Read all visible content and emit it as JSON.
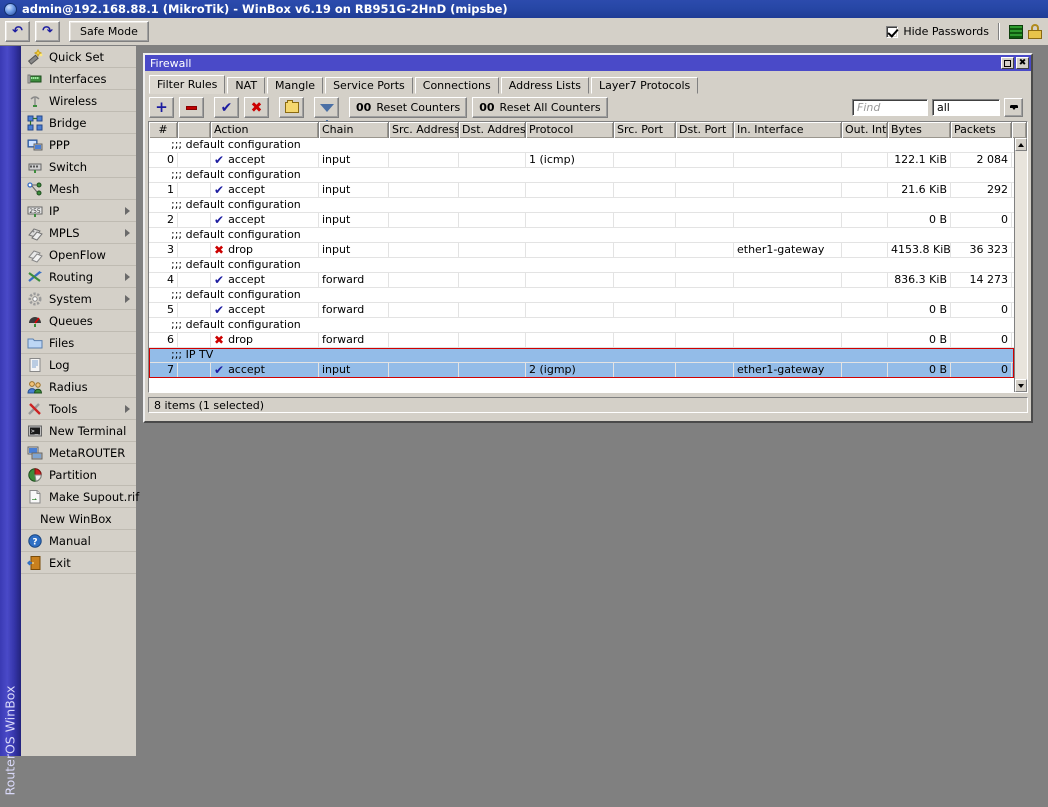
{
  "window": {
    "title": "admin@192.168.88.1 (MikroTik) - WinBox v6.19 on RB951G-2HnD (mipsbe)",
    "logo_icon": "winbox-globe-icon"
  },
  "main_toolbar": {
    "undo_label": "↶",
    "undo_icon": "undo-icon",
    "redo_label": "↷",
    "redo_icon": "redo-icon",
    "safe_mode_label": "Safe Mode",
    "hide_passwords_label": "Hide Passwords",
    "hide_passwords_checked": true,
    "bars_icon": "green-bars-icon",
    "lock_icon": "lock-icon"
  },
  "sidebar": {
    "vertical_label": "RouterOS WinBox",
    "items": [
      {
        "label": "Quick Set",
        "icon": "magic-wand-icon",
        "has_arrow": false
      },
      {
        "label": "Interfaces",
        "icon": "interfaces-icon",
        "has_arrow": false
      },
      {
        "label": "Wireless",
        "icon": "antenna-icon",
        "has_arrow": false
      },
      {
        "label": "Bridge",
        "icon": "bridge-icon",
        "has_arrow": false
      },
      {
        "label": "PPP",
        "icon": "ppp-icon",
        "has_arrow": false
      },
      {
        "label": "Switch",
        "icon": "switch-icon",
        "has_arrow": false
      },
      {
        "label": "Mesh",
        "icon": "mesh-icon",
        "has_arrow": false
      },
      {
        "label": "IP",
        "icon": "ip-255-icon",
        "has_arrow": true
      },
      {
        "label": "MPLS",
        "icon": "mpls-tag-icon",
        "has_arrow": true
      },
      {
        "label": "OpenFlow",
        "icon": "openflow-tag-icon",
        "has_arrow": false
      },
      {
        "label": "Routing",
        "icon": "routing-icon",
        "has_arrow": true
      },
      {
        "label": "System",
        "icon": "gear-icon",
        "has_arrow": true
      },
      {
        "label": "Queues",
        "icon": "queues-gauge-icon",
        "has_arrow": false
      },
      {
        "label": "Files",
        "icon": "folder-icon",
        "has_arrow": false
      },
      {
        "label": "Log",
        "icon": "log-document-icon",
        "has_arrow": false
      },
      {
        "label": "Radius",
        "icon": "radius-users-icon",
        "has_arrow": false
      },
      {
        "label": "Tools",
        "icon": "tools-wrench-icon",
        "has_arrow": true
      },
      {
        "label": "New Terminal",
        "icon": "terminal-icon",
        "has_arrow": false
      },
      {
        "label": "MetaROUTER",
        "icon": "metarouter-icon",
        "has_arrow": false
      },
      {
        "label": "Partition",
        "icon": "pie-chart-icon",
        "has_arrow": false
      },
      {
        "label": "Make Supout.rif",
        "icon": "supout-file-icon",
        "has_arrow": false
      },
      {
        "label": "New WinBox",
        "icon": "",
        "has_arrow": false
      },
      {
        "label": "Manual",
        "icon": "question-mark-icon",
        "has_arrow": false
      },
      {
        "label": "Exit",
        "icon": "exit-door-icon",
        "has_arrow": false
      }
    ]
  },
  "firewall": {
    "title": "Firewall",
    "maximize_icon": "maximize-icon",
    "close_label": "✖",
    "close_icon": "close-icon",
    "tabs": [
      {
        "label": "Filter Rules",
        "active": true
      },
      {
        "label": "NAT",
        "active": false
      },
      {
        "label": "Mangle",
        "active": false
      },
      {
        "label": "Service Ports",
        "active": false
      },
      {
        "label": "Connections",
        "active": false
      },
      {
        "label": "Address Lists",
        "active": false
      },
      {
        "label": "Layer7 Protocols",
        "active": false
      }
    ],
    "toolbar": {
      "add_icon": "plus-icon",
      "remove_icon": "minus-icon",
      "enable_icon": "check-icon",
      "disable_icon": "red-x-icon",
      "comment_icon": "folder-icon",
      "filter_icon": "funnel-icon",
      "reset_counters_prefix": "00",
      "reset_counters_label": "Reset Counters",
      "reset_all_counters_prefix": "00",
      "reset_all_counters_label": "Reset All Counters",
      "find_placeholder": "Find",
      "find_value": "",
      "filter_selected": "all",
      "dropdown_icon": "chevron-down-icon"
    },
    "columns": [
      "#",
      "",
      "Action",
      "Chain",
      "Src. Address",
      "Dst. Address",
      "Protocol",
      "Src. Port",
      "Dst. Port",
      "In. Interface",
      "Out. Int...",
      "Bytes",
      "Packets"
    ],
    "rows": [
      {
        "type": "comment",
        "text": ";;; default configuration",
        "selected": false
      },
      {
        "type": "rule",
        "index": "0",
        "action": "accept",
        "action_icon": "check-icon",
        "chain": "input",
        "src_address": "",
        "dst_address": "",
        "protocol": "1 (icmp)",
        "src_port": "",
        "dst_port": "",
        "in_interface": "",
        "out_interface": "",
        "bytes": "122.1 KiB",
        "packets": "2 084",
        "selected": false
      },
      {
        "type": "comment",
        "text": ";;; default configuration",
        "selected": false
      },
      {
        "type": "rule",
        "index": "1",
        "action": "accept",
        "action_icon": "check-icon",
        "chain": "input",
        "src_address": "",
        "dst_address": "",
        "protocol": "",
        "src_port": "",
        "dst_port": "",
        "in_interface": "",
        "out_interface": "",
        "bytes": "21.6 KiB",
        "packets": "292",
        "selected": false
      },
      {
        "type": "comment",
        "text": ";;; default configuration",
        "selected": false
      },
      {
        "type": "rule",
        "index": "2",
        "action": "accept",
        "action_icon": "check-icon",
        "chain": "input",
        "src_address": "",
        "dst_address": "",
        "protocol": "",
        "src_port": "",
        "dst_port": "",
        "in_interface": "",
        "out_interface": "",
        "bytes": "0 B",
        "packets": "0",
        "selected": false
      },
      {
        "type": "comment",
        "text": ";;; default configuration",
        "selected": false
      },
      {
        "type": "rule",
        "index": "3",
        "action": "drop",
        "action_icon": "red-x-icon",
        "chain": "input",
        "src_address": "",
        "dst_address": "",
        "protocol": "",
        "src_port": "",
        "dst_port": "",
        "in_interface": "ether1-gateway",
        "out_interface": "",
        "bytes": "4153.8 KiB",
        "packets": "36 323",
        "selected": false
      },
      {
        "type": "comment",
        "text": ";;; default configuration",
        "selected": false
      },
      {
        "type": "rule",
        "index": "4",
        "action": "accept",
        "action_icon": "check-icon",
        "chain": "forward",
        "src_address": "",
        "dst_address": "",
        "protocol": "",
        "src_port": "",
        "dst_port": "",
        "in_interface": "",
        "out_interface": "",
        "bytes": "836.3 KiB",
        "packets": "14 273",
        "selected": false
      },
      {
        "type": "comment",
        "text": ";;; default configuration",
        "selected": false
      },
      {
        "type": "rule",
        "index": "5",
        "action": "accept",
        "action_icon": "check-icon",
        "chain": "forward",
        "src_address": "",
        "dst_address": "",
        "protocol": "",
        "src_port": "",
        "dst_port": "",
        "in_interface": "",
        "out_interface": "",
        "bytes": "0 B",
        "packets": "0",
        "selected": false
      },
      {
        "type": "comment",
        "text": ";;; default configuration",
        "selected": false
      },
      {
        "type": "rule",
        "index": "6",
        "action": "drop",
        "action_icon": "red-x-icon",
        "chain": "forward",
        "src_address": "",
        "dst_address": "",
        "protocol": "",
        "src_port": "",
        "dst_port": "",
        "in_interface": "",
        "out_interface": "",
        "bytes": "0 B",
        "packets": "0",
        "selected": false
      },
      {
        "type": "comment",
        "text": ";;; IP TV",
        "selected": true
      },
      {
        "type": "rule",
        "index": "7",
        "action": "accept",
        "action_icon": "check-icon",
        "chain": "input",
        "src_address": "",
        "dst_address": "",
        "protocol": "2 (igmp)",
        "src_port": "",
        "dst_port": "",
        "in_interface": "ether1-gateway",
        "out_interface": "",
        "bytes": "0 B",
        "packets": "0",
        "selected": true
      }
    ],
    "status": "8 items (1 selected)"
  }
}
